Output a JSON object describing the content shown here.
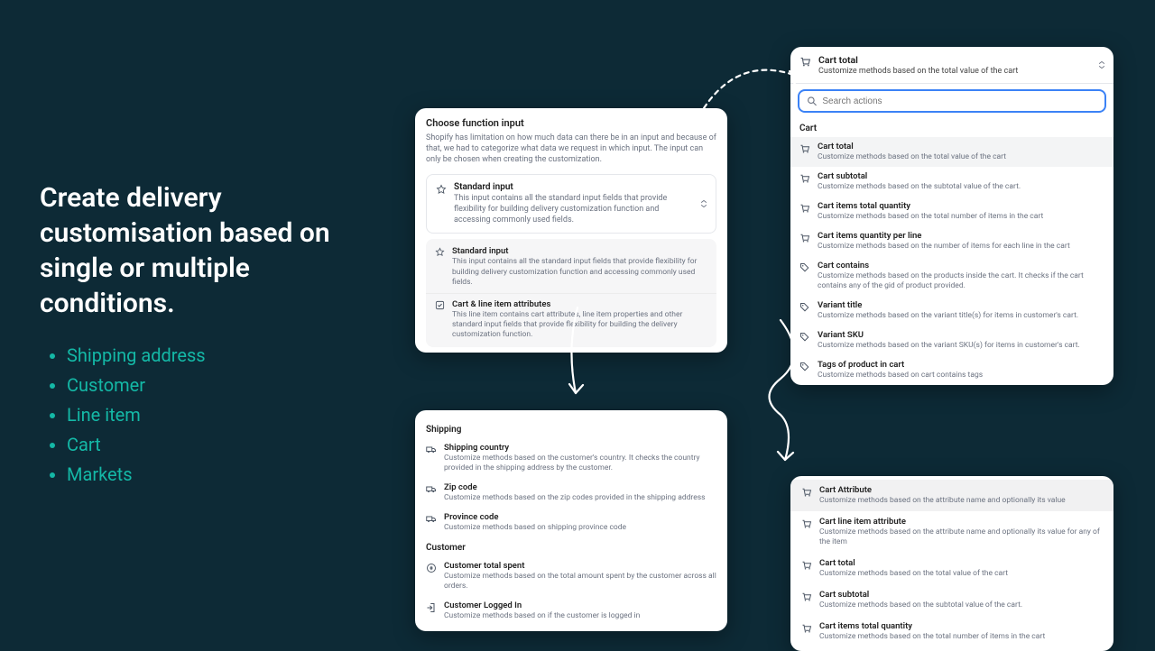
{
  "headline": "Create delivery customisation based on single or multiple conditions.",
  "bullets": [
    "Shipping address",
    "Customer",
    "Line item",
    "Cart",
    "Markets"
  ],
  "panel1": {
    "title": "Choose function input",
    "desc": "Shopify has limitation on how much data can there be in an input and because of that, we had to categorize what data we request in which input. The input can only be chosen when creating the customization.",
    "selected": {
      "title": "Standard input",
      "desc": "This input contains all the standard input fields that provide flexibility for building delivery customization function and accessing commonly used fields."
    },
    "options": [
      {
        "title": "Standard input",
        "desc": "This input contains all the standard input fields that provide flexibility for building delivery customization function and accessing commonly used fields.",
        "icon": "star"
      },
      {
        "title": "Cart & line item attributes",
        "desc": "This line item contains cart attributes, line item properties and other standard input fields that provide flexibility for building the delivery customization function.",
        "icon": "check"
      }
    ]
  },
  "panel2": {
    "header": {
      "title": "Cart total",
      "desc": "Customize methods based on the total value of the cart"
    },
    "search_placeholder": "Search actions",
    "section": "Cart",
    "items": [
      {
        "title": "Cart total",
        "desc": "Customize methods based on the total value of the cart",
        "icon": "cart",
        "selected": true
      },
      {
        "title": "Cart subtotal",
        "desc": "Customize methods based on the subtotal value of the cart.",
        "icon": "cart"
      },
      {
        "title": "Cart items total quantity",
        "desc": "Customize methods based on the total number of items in the cart",
        "icon": "cart"
      },
      {
        "title": "Cart items quantity per line",
        "desc": "Customize methods based on the number of items for each line in the cart",
        "icon": "cart"
      },
      {
        "title": "Cart contains",
        "desc": "Customize methods based on the products inside the cart. It checks if the cart contains any of the gid of product provided.",
        "icon": "tag"
      },
      {
        "title": "Variant title",
        "desc": "Customize methods based on the variant title(s) for items in customer's cart.",
        "icon": "tag"
      },
      {
        "title": "Variant SKU",
        "desc": "Customize methods based on the variant SKU(s) for items in customer's cart.",
        "icon": "tag"
      },
      {
        "title": "Tags of product in cart",
        "desc": "Customize methods based on cart contains tags",
        "icon": "tag"
      }
    ]
  },
  "panel3": {
    "sections": [
      {
        "label": "Shipping",
        "items": [
          {
            "title": "Shipping country",
            "desc": "Customize methods based on the customer's country. It checks the country provided in the shipping address by the customer.",
            "icon": "truck"
          },
          {
            "title": "Zip code",
            "desc": "Customize methods based on the zip codes provided in the shipping address",
            "icon": "truck"
          },
          {
            "title": "Province code",
            "desc": "Customize methods based on shipping province code",
            "icon": "truck"
          }
        ]
      },
      {
        "label": "Customer",
        "items": [
          {
            "title": "Customer total spent",
            "desc": "Customize methods based on the total amount spent by the customer across all orders.",
            "icon": "money"
          },
          {
            "title": "Customer Logged In",
            "desc": "Customize methods based on if the customer is logged in",
            "icon": "login"
          }
        ]
      }
    ]
  },
  "panel4": {
    "items": [
      {
        "title": "Cart Attribute",
        "desc": "Customize methods based on the attribute name and optionally its value",
        "icon": "cart",
        "selected": true
      },
      {
        "title": "Cart line item attribute",
        "desc": "Customize methods based on the attribute name and optionally its value for any of the item",
        "icon": "cart"
      },
      {
        "title": "Cart total",
        "desc": "Customize methods based on the total value of the cart",
        "icon": "cart"
      },
      {
        "title": "Cart subtotal",
        "desc": "Customize methods based on the subtotal value of the cart.",
        "icon": "cart"
      },
      {
        "title": "Cart items total quantity",
        "desc": "Customize methods based on the total number of items in the cart",
        "icon": "cart"
      }
    ]
  }
}
